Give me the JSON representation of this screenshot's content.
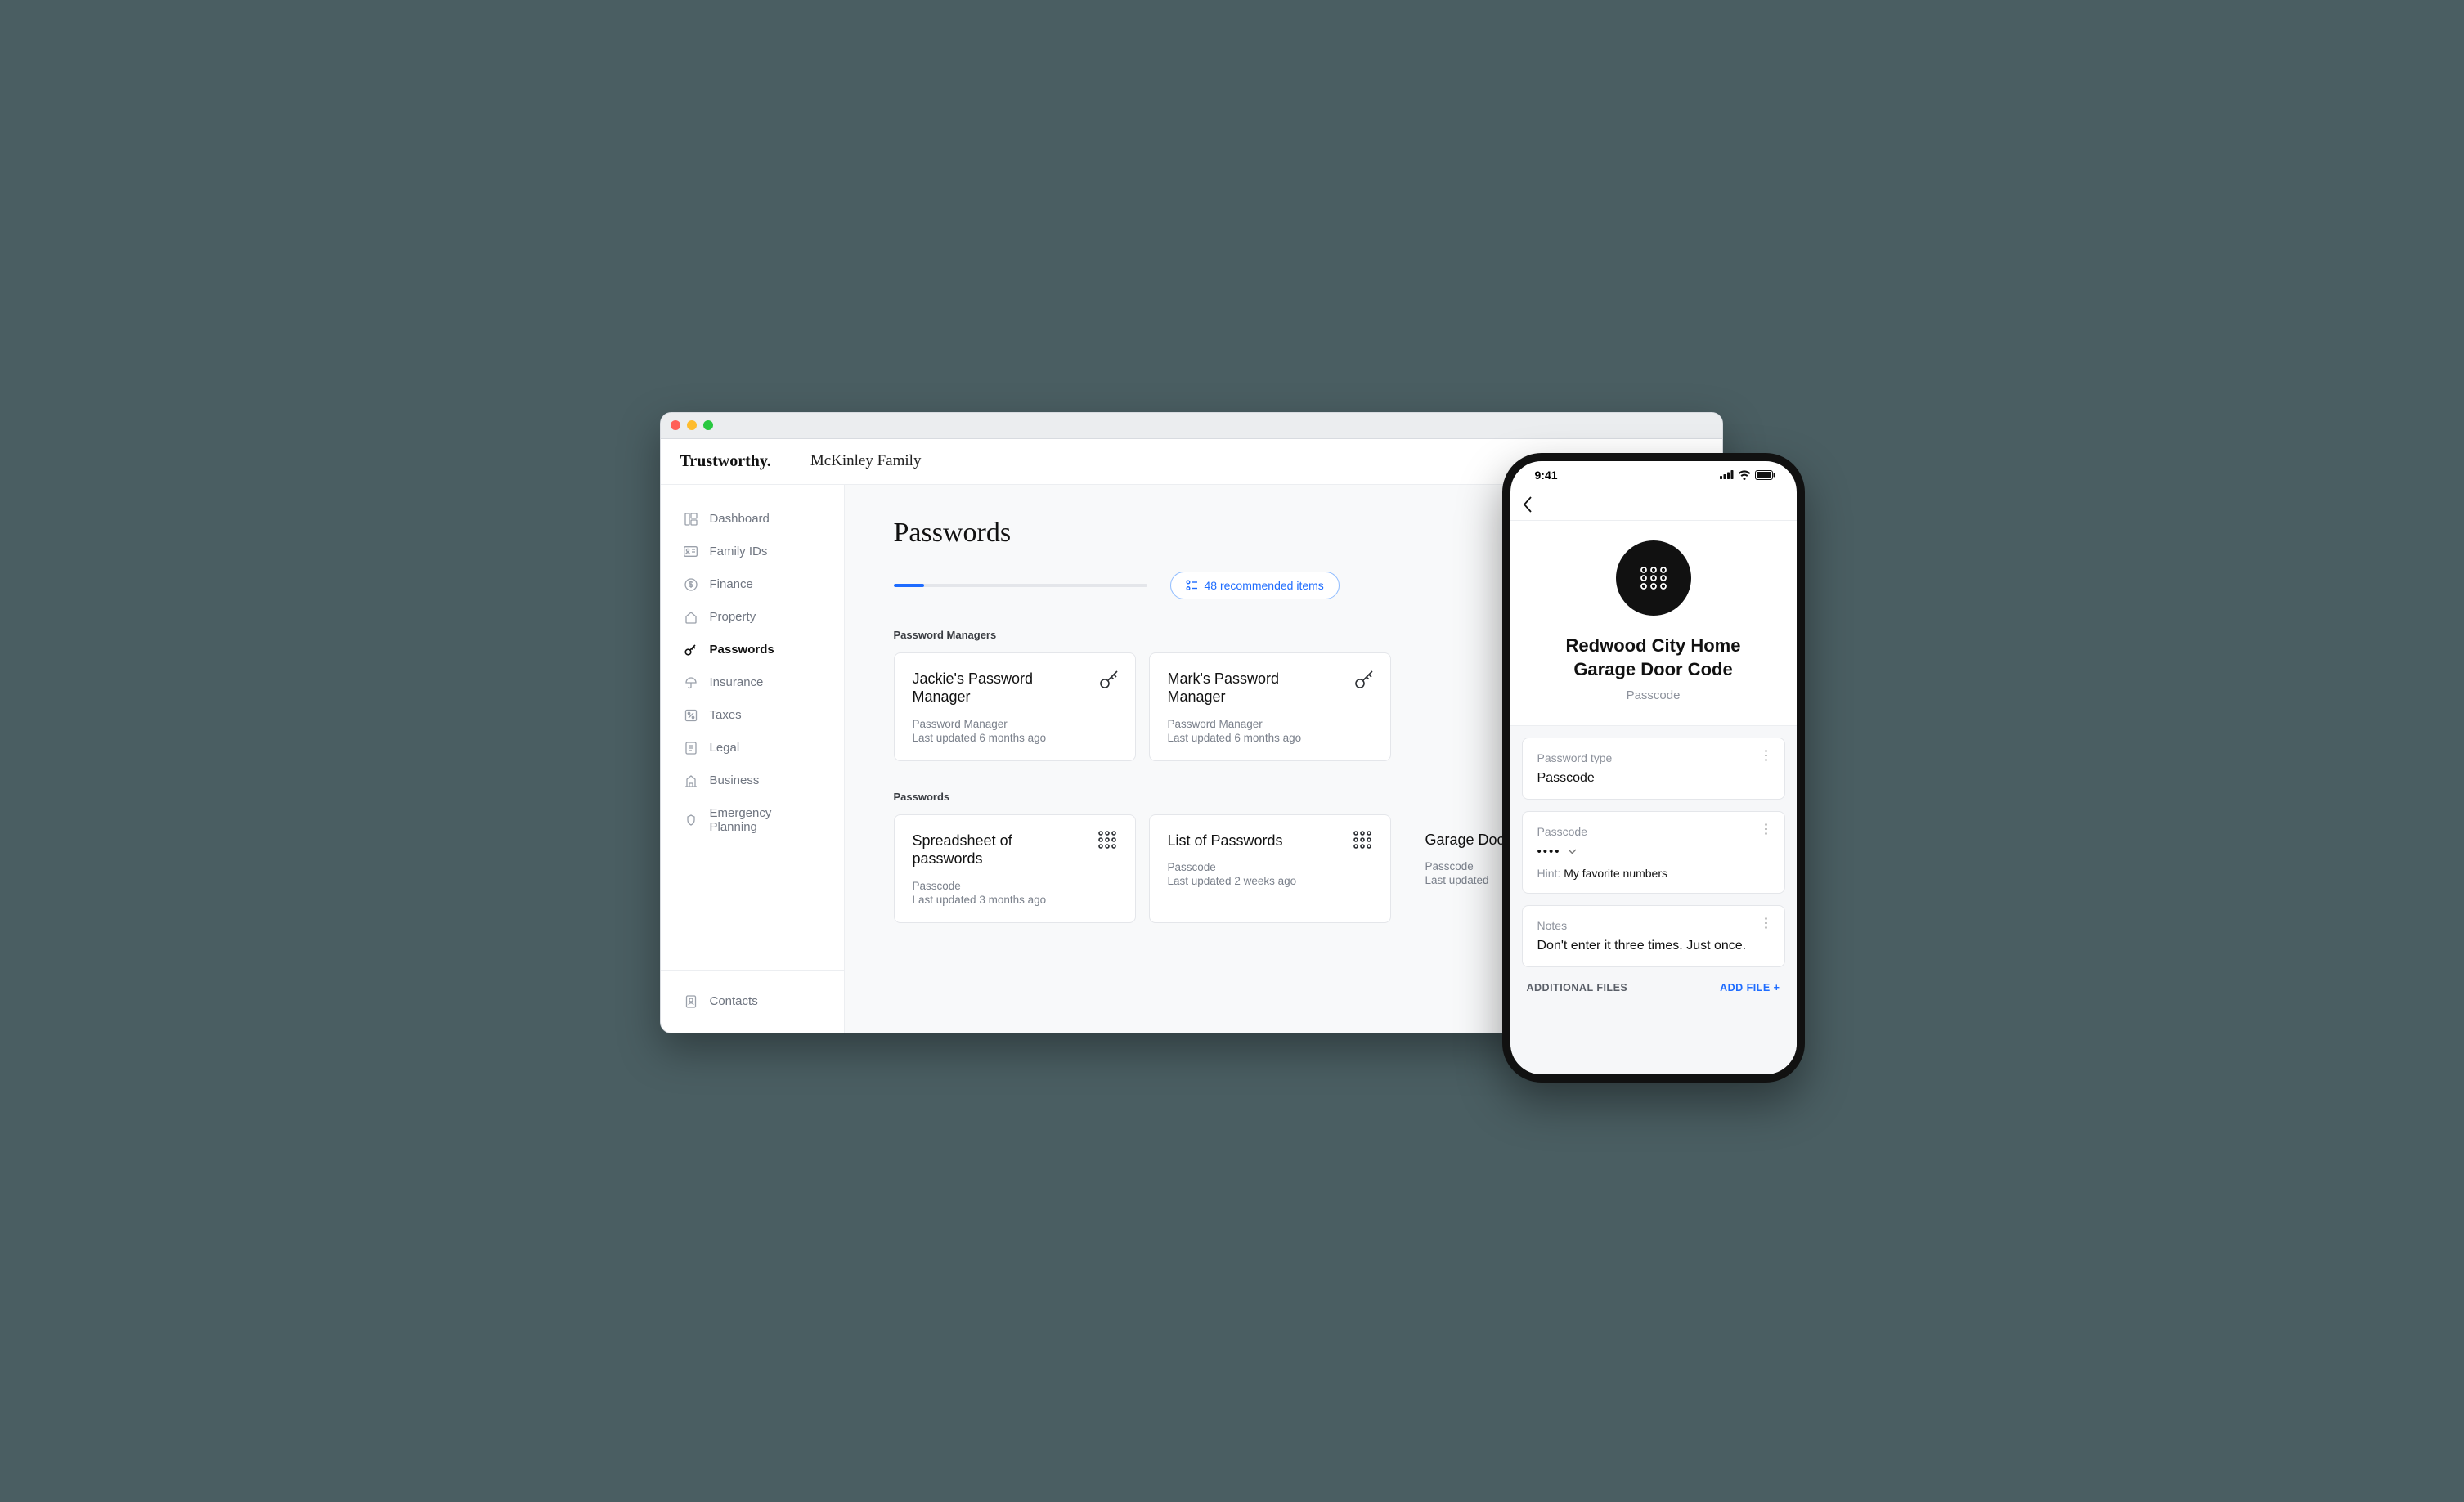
{
  "brand": "Trustworthy.",
  "family_name": "McKinley Family",
  "sidebar": {
    "items": [
      {
        "label": "Dashboard"
      },
      {
        "label": "Family IDs"
      },
      {
        "label": "Finance"
      },
      {
        "label": "Property"
      },
      {
        "label": "Passwords"
      },
      {
        "label": "Insurance"
      },
      {
        "label": "Taxes"
      },
      {
        "label": "Legal"
      },
      {
        "label": "Business"
      },
      {
        "label": "Emergency Planning"
      }
    ],
    "footer_label": "Contacts"
  },
  "main": {
    "title": "Passwords",
    "recommended_label": "48 recommended items",
    "sections": {
      "managers": {
        "label": "Password Managers",
        "cards": [
          {
            "title": "Jackie's Password Manager",
            "type": "Password Manager",
            "updated": "Last updated 6 months ago"
          },
          {
            "title": "Mark's Password Manager",
            "type": "Password Manager",
            "updated": "Last updated 6 months ago"
          }
        ]
      },
      "passwords": {
        "label": "Passwords",
        "cards": [
          {
            "title": "Spreadsheet of passwords",
            "type": "Passcode",
            "updated": "Last updated 3 months ago"
          },
          {
            "title": "List of Passwords",
            "type": "Passcode",
            "updated": "Last updated 2 weeks ago"
          },
          {
            "title": "Garage Door",
            "type": "Passcode",
            "updated": "Last updated"
          }
        ]
      }
    }
  },
  "phone": {
    "time": "9:41",
    "title_line1": "Redwood City Home",
    "title_line2": "Garage Door Code",
    "subtitle": "Passcode",
    "fields": {
      "type": {
        "label": "Password type",
        "value": "Passcode"
      },
      "passcode": {
        "label": "Passcode",
        "masked": "••••",
        "hint_label": "Hint:",
        "hint_value": "My favorite numbers"
      },
      "notes": {
        "label": "Notes",
        "value": "Don't enter it three times. Just once."
      }
    },
    "footer": {
      "left": "ADDITIONAL FILES",
      "right": "ADD FILE +"
    }
  }
}
